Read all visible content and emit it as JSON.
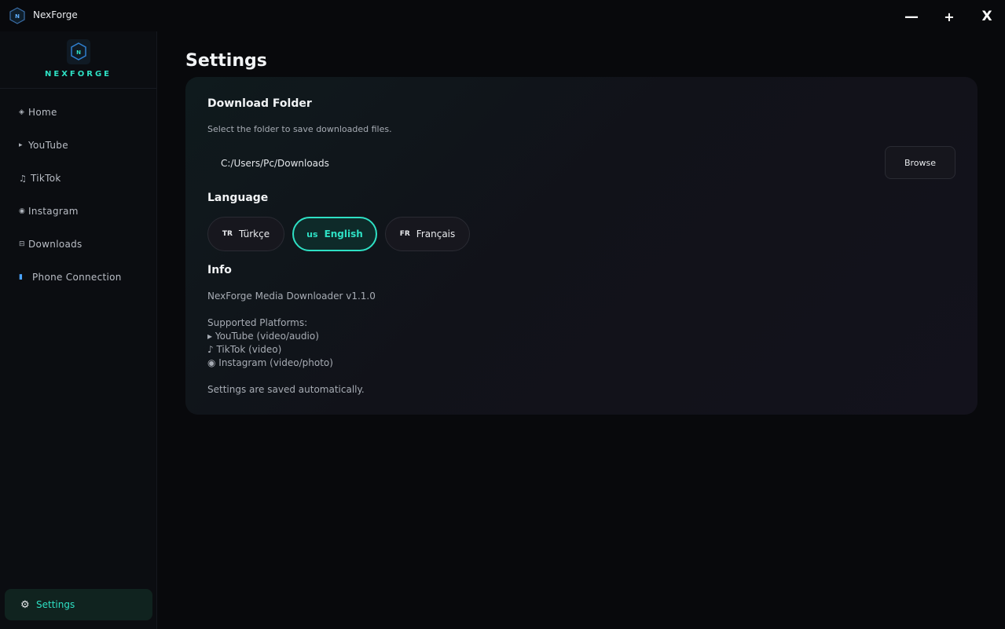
{
  "window": {
    "title": "NexForge",
    "minimize_label": "—",
    "maximize_label": "+",
    "close_label": "X"
  },
  "sidebar": {
    "brand": "NEXFORGE",
    "items": [
      {
        "label": "Home",
        "icon": "diamond-icon",
        "glyph": "◈"
      },
      {
        "label": "YouTube",
        "icon": "play-icon",
        "glyph": "▸"
      },
      {
        "label": "TikTok",
        "icon": "music-note-icon",
        "glyph": "♫"
      },
      {
        "label": "Instagram",
        "icon": "instagram-icon",
        "glyph": "◉"
      },
      {
        "label": "Downloads",
        "icon": "downloads-icon",
        "glyph": "⊟"
      },
      {
        "label": "Phone Connection",
        "icon": "phone-icon",
        "glyph": "▮"
      }
    ],
    "settings_item": {
      "label": "Settings",
      "icon": "gear-icon",
      "glyph": "⚙"
    }
  },
  "main": {
    "title": "Settings",
    "download_folder": {
      "title": "Download Folder",
      "description": "Select the folder to save downloaded files.",
      "path": "C:/Users/Pc/Downloads",
      "browse_label": "Browse"
    },
    "language": {
      "title": "Language",
      "options": [
        {
          "code": "TR",
          "label": "Türkçe",
          "selected": false
        },
        {
          "code": "us",
          "label": "English",
          "selected": true
        },
        {
          "code": "FR",
          "label": "Français",
          "selected": false
        }
      ]
    },
    "info": {
      "title": "Info",
      "version": "NexForge Media Downloader v1.1.0",
      "platforms_heading": "Supported Platforms:",
      "platforms": [
        "▸ YouTube (video/audio)",
        "♪ TikTok (video)",
        "◉ Instagram (video/photo)"
      ],
      "autosave_note": "Settings are saved automatically."
    }
  },
  "colors": {
    "accent": "#2ee0c4",
    "background": "#08090c",
    "sidebar": "#0b0d11",
    "card": "#111219"
  }
}
